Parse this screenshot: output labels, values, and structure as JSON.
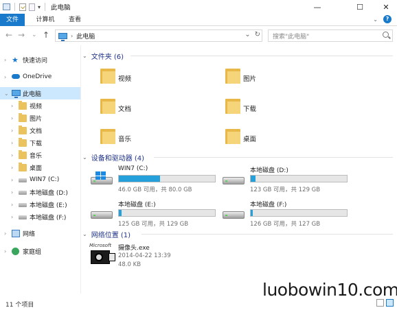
{
  "window": {
    "title": "此电脑",
    "minimize_glyph": "—",
    "maximize_glyph": "☐",
    "close_glyph": "✕",
    "quick_access_dropdown": "▾"
  },
  "ribbon": {
    "tabs": [
      {
        "label": "文件",
        "active": true
      },
      {
        "label": "计算机",
        "active": false
      },
      {
        "label": "查看",
        "active": false
      }
    ],
    "collapse_glyph": "⌄",
    "help_glyph": "?"
  },
  "navigation": {
    "back_glyph": "←",
    "forward_glyph": "→",
    "history_glyph": "⌄",
    "up_glyph": "↑",
    "address_separator": "›",
    "address_path": "此电脑",
    "address_dropdown": "⌄",
    "refresh_glyph": "↻",
    "search_placeholder": "搜索\"此电脑\""
  },
  "sidebar": {
    "items": [
      {
        "label": "快速访问",
        "icon": "star-icon",
        "level": 0,
        "caret": "›"
      },
      {
        "label": "OneDrive",
        "icon": "cloud-icon",
        "level": 0,
        "caret": "›"
      },
      {
        "label": "此电脑",
        "icon": "computer-icon",
        "level": 0,
        "caret": "⌄",
        "selected": true
      },
      {
        "label": "视频",
        "icon": "video-folder-icon",
        "level": 1,
        "caret": "›"
      },
      {
        "label": "图片",
        "icon": "pictures-folder-icon",
        "level": 1,
        "caret": "›"
      },
      {
        "label": "文档",
        "icon": "documents-folder-icon",
        "level": 1,
        "caret": "›"
      },
      {
        "label": "下载",
        "icon": "download-folder-icon",
        "level": 1,
        "caret": "›"
      },
      {
        "label": "音乐",
        "icon": "music-folder-icon",
        "level": 1,
        "caret": "›"
      },
      {
        "label": "桌面",
        "icon": "desktop-folder-icon",
        "level": 1,
        "caret": "›"
      },
      {
        "label": "WIN7 (C:)",
        "icon": "drive-icon",
        "level": 1,
        "caret": "›"
      },
      {
        "label": "本地磁盘 (D:)",
        "icon": "drive-icon",
        "level": 1,
        "caret": "›"
      },
      {
        "label": "本地磁盘 (E:)",
        "icon": "drive-icon",
        "level": 1,
        "caret": "›"
      },
      {
        "label": "本地磁盘 (F:)",
        "icon": "drive-icon",
        "level": 1,
        "caret": "›"
      },
      {
        "label": "网络",
        "icon": "network-icon",
        "level": 0,
        "caret": "›"
      },
      {
        "label": "家庭组",
        "icon": "homegroup-icon",
        "level": 0,
        "caret": "›"
      }
    ]
  },
  "groups": {
    "folders": {
      "title": "文件夹 (6)",
      "caret": "⌄"
    },
    "devices": {
      "title": "设备和驱动器 (4)",
      "caret": "⌄"
    },
    "network": {
      "title": "网络位置 (1)",
      "caret": "⌄"
    }
  },
  "folders": [
    {
      "label": "视频",
      "icon": "video-folder-icon"
    },
    {
      "label": "图片",
      "icon": "pictures-folder-icon"
    },
    {
      "label": "文档",
      "icon": "documents-folder-icon"
    },
    {
      "label": "下载",
      "icon": "download-folder-icon"
    },
    {
      "label": "音乐",
      "icon": "music-folder-icon"
    },
    {
      "label": "桌面",
      "icon": "desktop-folder-icon"
    }
  ],
  "drives": [
    {
      "name": "WIN7 (C:)",
      "usage": "46.0 GB 可用，共 80.0 GB",
      "used_fraction": 0.43,
      "system": true
    },
    {
      "name": "本地磁盘 (D:)",
      "usage": "123 GB 可用，共 129 GB",
      "used_fraction": 0.05,
      "system": false
    },
    {
      "name": "本地磁盘 (E:)",
      "usage": "125 GB 可用，共 129 GB",
      "used_fraction": 0.03,
      "system": false
    },
    {
      "name": "本地磁盘 (F:)",
      "usage": "126 GB 可用，共 127 GB",
      "used_fraction": 0.02,
      "system": false
    }
  ],
  "network_items": [
    {
      "name": "摄像头.exe",
      "date": "2014-04-22 13:39",
      "size": "48.0 KB",
      "logo_text": "Microsoft"
    }
  ],
  "status": {
    "item_count": "11 个项目"
  },
  "watermark": "luobowin10.com",
  "colors": {
    "accent": "#1979ca",
    "selected": "#cce8ff",
    "bar_fill": "#26a0da",
    "group_header": "#1e3287"
  }
}
